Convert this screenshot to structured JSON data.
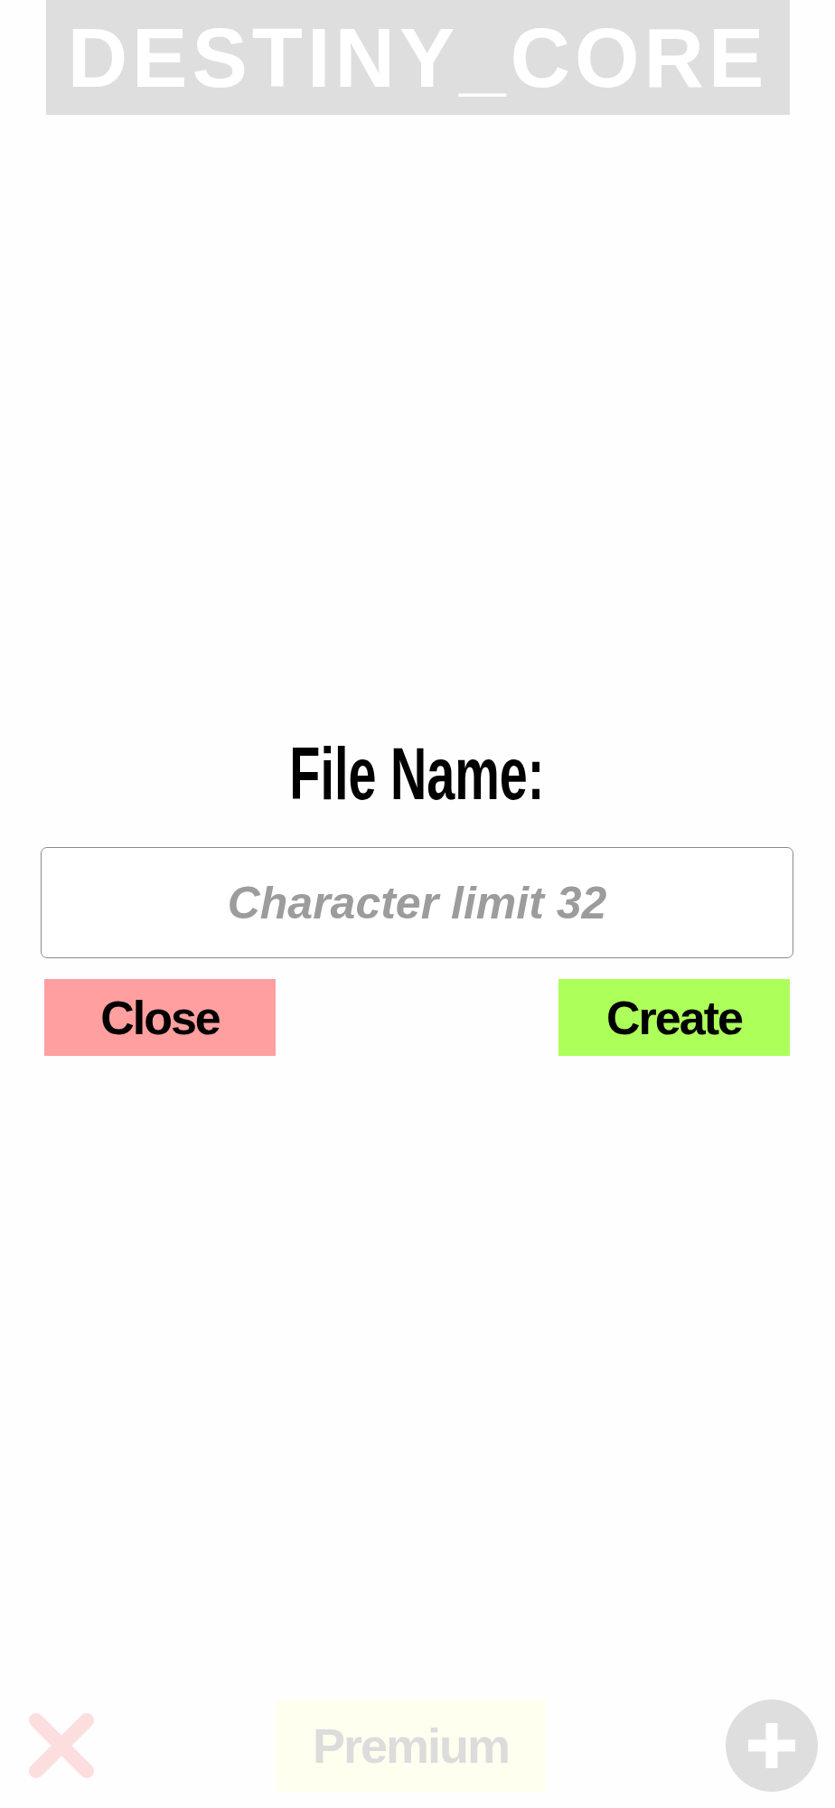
{
  "header": {
    "title": "DESTINY_CORE"
  },
  "dialog": {
    "label": "File Name:",
    "input": {
      "placeholder": "Character limit 32"
    },
    "buttons": [
      {
        "kind": "close",
        "label": "Close"
      },
      {
        "kind": "create",
        "label": "Create"
      }
    ]
  },
  "bottom_bar": {
    "premium_button": {
      "label": "Premium"
    }
  }
}
